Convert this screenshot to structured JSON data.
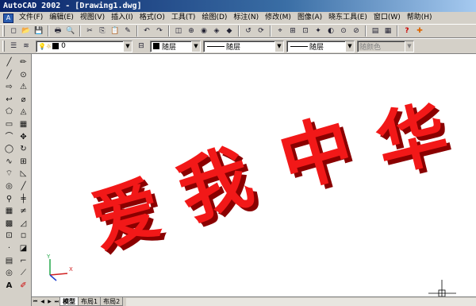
{
  "window": {
    "title": "AutoCAD 2002 - [Drawing1.dwg]"
  },
  "menu": [
    "文件(F)",
    "编辑(E)",
    "视图(V)",
    "插入(I)",
    "格式(O)",
    "工具(T)",
    "绘图(D)",
    "标注(N)",
    "修改(M)",
    "图像(A)",
    "晓东工具(E)",
    "窗口(W)",
    "帮助(H)"
  ],
  "properties_toolbar": {
    "layer_value": "0",
    "color_value": "随层",
    "linetype_value": "随层",
    "lineweight_value": "随层",
    "plotstyle_value": "随颜色"
  },
  "canvas": {
    "text_characters": [
      "爱",
      "我",
      "中",
      "华"
    ],
    "text_color": "#f21818",
    "shadow_color": "#8a0000",
    "ucs_x_label": "X",
    "ucs_y_label": "Y"
  },
  "tabs": [
    "模型",
    "布局1",
    "布局2"
  ],
  "active_tab": "模型",
  "nav_arrows": [
    "⏮",
    "◀",
    "▶",
    "⏭"
  ],
  "toolbar1_icons": [
    "◻",
    "📂",
    "💾",
    "🖶",
    "🔍",
    "✂",
    "⎘",
    "📋",
    "✎",
    "↶",
    "↷",
    "◫",
    "⊕",
    "◉",
    "◈",
    "◆",
    "↺",
    "⟳",
    "⌖",
    "⊞",
    "⊡",
    "✦",
    "◐",
    "⊙",
    "⊘",
    "▤",
    "▦",
    "?",
    "✚"
  ],
  "left_col1_icons": [
    "╱",
    "╱",
    "⇨",
    "↩",
    "⬠",
    "▭",
    "⌒",
    "◯",
    "∿",
    "⌔",
    "◎",
    "⚲",
    "▦",
    "▩",
    "⊡",
    "·",
    "▤",
    "◎",
    "A"
  ],
  "left_col2_icons": [
    "✏",
    "⊙",
    "⚠",
    "⌀",
    "◬",
    "▦",
    "✥",
    "↻",
    "⊞",
    "◺",
    "╱",
    "╪",
    "≠",
    "◿",
    "◽",
    "◪",
    "⌐",
    "⟋",
    "✐"
  ]
}
